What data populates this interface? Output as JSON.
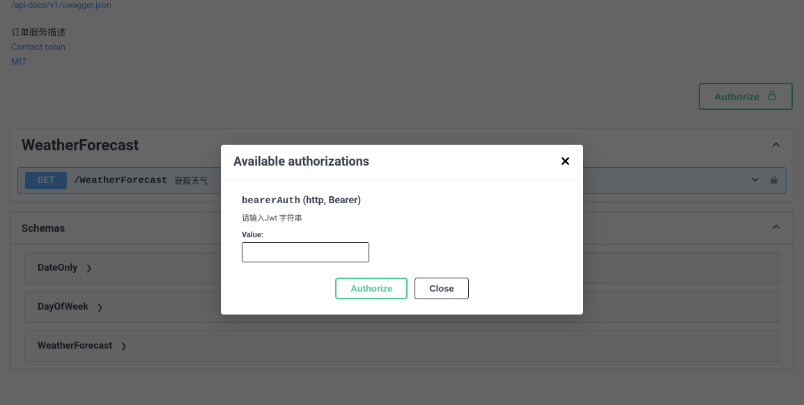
{
  "header": {
    "api_link": "/api-docs/v1/swagger.json",
    "description": "订单服务描述",
    "contact_label": "Contact robin",
    "license_label": "MIT"
  },
  "authorize_button_label": "Authorize",
  "tag": {
    "title": "WeatherForecast",
    "endpoint": {
      "method": "GET",
      "path": "/WeatherForecast",
      "description": "获取天气"
    }
  },
  "schemas": {
    "title": "Schemas",
    "items": [
      "DateOnly",
      "DayOfWeek",
      "WeatherForecast"
    ]
  },
  "modal": {
    "title": "Available authorizations",
    "auth_name": "bearerAuth",
    "auth_type": "  (http, Bearer)",
    "hint": "请输入Jwt 字符串",
    "value_label": "Value:",
    "value": "",
    "authorize_label": "Authorize",
    "close_label": "Close"
  }
}
